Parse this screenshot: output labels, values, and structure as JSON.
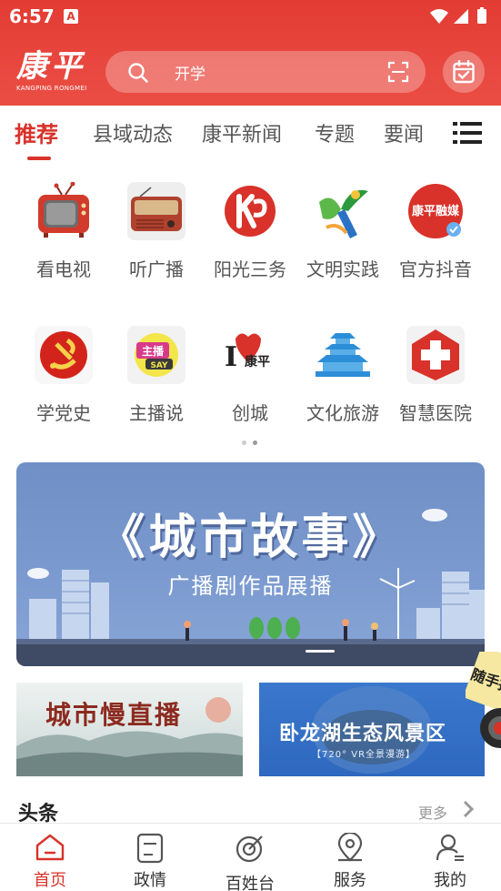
{
  "status_bar": {
    "time": "6:57",
    "notification_icon": "A"
  },
  "header": {
    "logo_text": "康平",
    "logo_subtext": "KANGPING RONGMEI",
    "search_placeholder": "开学",
    "icons": [
      "search-icon",
      "scan-icon",
      "calendar-check-icon"
    ]
  },
  "tabs": {
    "items": [
      "推荐",
      "县域动态",
      "康平新闻",
      "专题",
      "要闻"
    ],
    "active_index": 0
  },
  "grid": {
    "items": [
      {
        "label": "看电视",
        "icon": "tv-icon"
      },
      {
        "label": "听广播",
        "icon": "radio-icon"
      },
      {
        "label": "阳光三务",
        "icon": "kp-logo-icon"
      },
      {
        "label": "文明实践",
        "icon": "civilization-icon"
      },
      {
        "label": "官方抖音",
        "icon": "douyin-icon"
      },
      {
        "label": "学党史",
        "icon": "party-icon"
      },
      {
        "label": "主播说",
        "icon": "anchor-say-icon"
      },
      {
        "label": "创城",
        "icon": "i-love-kangping-icon"
      },
      {
        "label": "文化旅游",
        "icon": "pagoda-icon"
      },
      {
        "label": "智慧医院",
        "icon": "hospital-cross-icon"
      }
    ],
    "icon_texts": {
      "anchor": "主播",
      "say": "SAY",
      "love_i": "I",
      "love_kp": "康平",
      "douyin_title": "康平融媒"
    },
    "page_indicator": {
      "pages": 2,
      "current": 2
    }
  },
  "banner": {
    "title": "《城市故事》",
    "subtitle": "广播剧作品展播"
  },
  "small_banners": [
    {
      "title": "城市慢直播"
    },
    {
      "title": "卧龙湖生态风景区",
      "subtitle": "【720° VR全景漫游】"
    }
  ],
  "sticker": {
    "text": "随手拍"
  },
  "section": {
    "title": "头条",
    "more": "更多"
  },
  "bottom_nav": {
    "items": [
      {
        "label": "首页",
        "icon": "home-icon"
      },
      {
        "label": "政情",
        "icon": "document-icon"
      },
      {
        "label": "百姓台",
        "icon": "target-icon"
      },
      {
        "label": "服务",
        "icon": "map-pin-icon"
      },
      {
        "label": "我的",
        "icon": "user-icon"
      }
    ],
    "active_index": 0
  },
  "colors": {
    "brand_red": "#d8322a",
    "header_red": "#e23b33",
    "banner_blue": "#7c9bd0"
  }
}
